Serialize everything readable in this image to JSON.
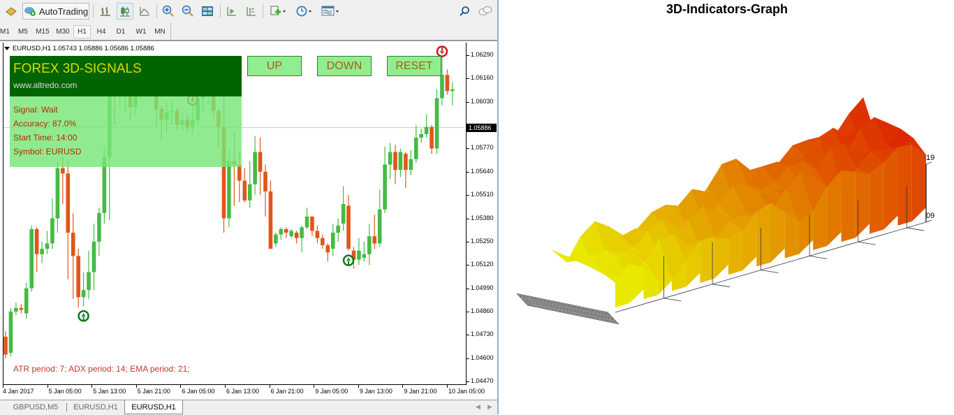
{
  "toolbar": {
    "autotrading_label": "AutoTrading",
    "icons": [
      "new-order-icon",
      "autotrading-icon",
      "bar-chart-icon",
      "candlestick-icon",
      "line-chart-icon",
      "zoom-in-icon",
      "zoom-out-icon",
      "tile-windows-icon",
      "scroll-chart-icon",
      "chart-shift-icon",
      "indicators-icon",
      "periods-icon",
      "templates-icon",
      "search-icon",
      "chat-icon"
    ]
  },
  "timeframes": [
    "M1",
    "M5",
    "M15",
    "M30",
    "H1",
    "H4",
    "D1",
    "W1",
    "MN"
  ],
  "active_timeframe": "H1",
  "chart": {
    "header": "EURUSD,H1  1.05743 1.05886 1.05686 1.05886",
    "symbol": "EURUSD",
    "timeframe": "H1",
    "ohlc": {
      "open": "1.05743",
      "high": "1.05886",
      "low": "1.05686",
      "close": "1.05886"
    },
    "current_price": "1.05886",
    "price_ticks": [
      "1.06290",
      "1.06160",
      "1.06030",
      "1.05770",
      "1.05640",
      "1.05510",
      "1.05380",
      "1.05250",
      "1.05120",
      "1.04990",
      "1.04860",
      "1.04730",
      "1.04600",
      "1.04470"
    ],
    "price_range": [
      1.0447,
      1.0629
    ],
    "time_ticks": [
      "4 Jan 2017",
      "5 Jan 05:00",
      "5 Jan 13:00",
      "5 Jan 21:00",
      "6 Jan 05:00",
      "6 Jan 13:00",
      "6 Jan 21:00",
      "9 Jan 05:00",
      "9 Jan 13:00",
      "9 Jan 21:00",
      "10 Jan 05:00"
    ],
    "colors": {
      "bull": "#44bb44",
      "bear": "#e0561a",
      "panel_dark": "#006400",
      "panel_light": "#8ee88e"
    },
    "candles": [
      [
        1.0472,
        1.0462,
        1.0475,
        1.046
      ],
      [
        1.0463,
        1.0486,
        1.0488,
        1.0461
      ],
      [
        1.0486,
        1.0488,
        1.0491,
        1.0484
      ],
      [
        1.0488,
        1.0487,
        1.049,
        1.0485
      ],
      [
        1.0485,
        1.0499,
        1.0502,
        1.0482
      ],
      [
        1.0499,
        1.0532,
        1.0534,
        1.0497
      ],
      [
        1.0532,
        1.0518,
        1.0533,
        1.0508
      ],
      [
        1.0518,
        1.0521,
        1.0525,
        1.0513
      ],
      [
        1.0521,
        1.0524,
        1.0531,
        1.0518
      ],
      [
        1.0524,
        1.0538,
        1.0549,
        1.0521
      ],
      [
        1.0538,
        1.0566,
        1.057,
        1.053
      ],
      [
        1.0566,
        1.0563,
        1.0572,
        1.0546
      ],
      [
        1.0563,
        1.053,
        1.0571,
        1.0504
      ],
      [
        1.053,
        1.0517,
        1.0541,
        1.0493
      ],
      [
        1.0517,
        1.0494,
        1.0521,
        1.0488
      ],
      [
        1.0494,
        1.0498,
        1.0508,
        1.0489
      ],
      [
        1.0498,
        1.0508,
        1.052,
        1.0493
      ],
      [
        1.0508,
        1.0525,
        1.0535,
        1.0498
      ],
      [
        1.0525,
        1.0541,
        1.0544,
        1.0517
      ],
      [
        1.0541,
        1.0572,
        1.0578,
        1.0535
      ],
      [
        1.0572,
        1.0613,
        1.0617,
        1.0537
      ],
      [
        1.0613,
        1.061,
        1.0623,
        1.059
      ],
      [
        1.0608,
        1.0608,
        1.0611,
        1.06
      ],
      [
        1.0608,
        1.0609,
        1.0616,
        1.0597
      ],
      [
        1.0609,
        1.06,
        1.0611,
        1.0593
      ],
      [
        1.06,
        1.0608,
        1.061,
        1.0595
      ],
      [
        1.0608,
        1.0617,
        1.062,
        1.0605
      ],
      [
        1.0617,
        1.0613,
        1.0619,
        1.0607
      ],
      [
        1.0613,
        1.0615,
        1.0624,
        1.061
      ],
      [
        1.0615,
        1.0599,
        1.0616,
        1.0589
      ],
      [
        1.0599,
        1.0593,
        1.0601,
        1.0582
      ],
      [
        1.0593,
        1.0597,
        1.0603,
        1.0586
      ],
      [
        1.0597,
        1.0598,
        1.0604,
        1.059
      ],
      [
        1.0598,
        1.059,
        1.06,
        1.0587
      ],
      [
        1.059,
        1.0593,
        1.0597,
        1.0587
      ],
      [
        1.0593,
        1.0589,
        1.0596,
        1.0586
      ],
      [
        1.0589,
        1.0593,
        1.0601,
        1.0585
      ],
      [
        1.0593,
        1.0605,
        1.0611,
        1.059
      ],
      [
        1.0605,
        1.0614,
        1.062,
        1.0597
      ],
      [
        1.0614,
        1.062,
        1.0623,
        1.0602
      ],
      [
        1.062,
        1.0598,
        1.0621,
        1.0594
      ],
      [
        1.0598,
        1.0589,
        1.0599,
        1.0577
      ],
      [
        1.0589,
        1.0538,
        1.0626,
        1.053
      ],
      [
        1.0538,
        1.057,
        1.0577,
        1.0533
      ],
      [
        1.057,
        1.0568,
        1.0586,
        1.0545
      ],
      [
        1.0568,
        1.0559,
        1.0575,
        1.0547
      ],
      [
        1.0559,
        1.0548,
        1.0566,
        1.0547
      ],
      [
        1.0548,
        1.0557,
        1.057,
        1.0544
      ],
      [
        1.0557,
        1.0575,
        1.0584,
        1.0551
      ],
      [
        1.0575,
        1.0564,
        1.0583,
        1.0551
      ],
      [
        1.0564,
        1.0553,
        1.0568,
        1.0539
      ],
      [
        1.0553,
        1.0521,
        1.0559,
        1.0522
      ],
      [
        1.0524,
        1.0529,
        1.053,
        1.0522
      ],
      [
        1.0529,
        1.0532,
        1.0533,
        1.0526
      ],
      [
        1.0532,
        1.053,
        1.0533,
        1.0527
      ],
      [
        1.0528,
        1.0531,
        1.0532,
        1.0527
      ],
      [
        1.053,
        1.0527,
        1.0531,
        1.0524
      ],
      [
        1.0527,
        1.0533,
        1.0534,
        1.0519
      ],
      [
        1.0533,
        1.0539,
        1.0544,
        1.0532
      ],
      [
        1.0539,
        1.0531,
        1.0539,
        1.0528
      ],
      [
        1.0531,
        1.0527,
        1.0534,
        1.0524
      ],
      [
        1.0527,
        1.0523,
        1.0529,
        1.0521
      ],
      [
        1.0523,
        1.0519,
        1.0524,
        1.0514
      ],
      [
        1.0521,
        1.053,
        1.0535,
        1.0517
      ],
      [
        1.053,
        1.0534,
        1.0538,
        1.0525
      ],
      [
        1.0535,
        1.0546,
        1.0556,
        1.0531
      ],
      [
        1.0545,
        1.0521,
        1.0551,
        1.052
      ],
      [
        1.052,
        1.0515,
        1.0522,
        1.051
      ],
      [
        1.0515,
        1.052,
        1.0527,
        1.0512
      ],
      [
        1.0516,
        1.0518,
        1.0525,
        1.0514
      ],
      [
        1.0518,
        1.0528,
        1.0535,
        1.0512
      ],
      [
        1.0528,
        1.0524,
        1.054,
        1.0521
      ],
      [
        1.0524,
        1.0543,
        1.0554,
        1.0522
      ],
      [
        1.0543,
        1.0568,
        1.0578,
        1.0541
      ],
      [
        1.0568,
        1.0575,
        1.058,
        1.056
      ],
      [
        1.0575,
        1.0565,
        1.0579,
        1.0557
      ],
      [
        1.0565,
        1.0575,
        1.0577,
        1.0561
      ],
      [
        1.0574,
        1.0565,
        1.0575,
        1.0555
      ],
      [
        1.0565,
        1.0571,
        1.0576,
        1.0562
      ],
      [
        1.0571,
        1.0583,
        1.059,
        1.0569
      ],
      [
        1.0583,
        1.0585,
        1.0588,
        1.058
      ],
      [
        1.0585,
        1.0589,
        1.0596,
        1.0583
      ],
      [
        1.0589,
        1.0577,
        1.059,
        1.0574
      ],
      [
        1.0577,
        1.0605,
        1.061,
        1.0574
      ],
      [
        1.0605,
        1.0618,
        1.0628,
        1.0601
      ],
      [
        1.0618,
        1.0609,
        1.0621,
        1.0607
      ],
      [
        1.0609,
        1.061,
        1.0614,
        1.0601
      ]
    ],
    "signals": [
      {
        "type": "down",
        "candle": 26
      },
      {
        "type": "down",
        "candle": 36
      },
      {
        "type": "up",
        "candle": 15
      },
      {
        "type": "up",
        "candle": 66
      },
      {
        "type": "down",
        "candle": 84
      }
    ]
  },
  "panel": {
    "title": "FOREX 3D-SIGNALS",
    "url": "www.altredo.com",
    "signal": "Signal: Wait",
    "accuracy": "Accuracy: 87.0%",
    "start_time": "Start Time: 14:00",
    "symbol": "Symbol: EURUSD"
  },
  "buttons": {
    "up": "UP",
    "down": "DOWN",
    "reset": "RESET"
  },
  "params_text": "ATR period: 7; ADX period: 14; EMA period: 21;",
  "tabs": [
    {
      "label": "GBPUSD,M5",
      "active": false
    },
    {
      "label": "EURUSD,H1",
      "active": false
    },
    {
      "label": "EURUSD,H1",
      "active": true
    }
  ],
  "graph3d": {
    "title": "3D-Indicators-Graph",
    "z_max_label": "19",
    "z_min_label": "09",
    "color_low": "#e8e800",
    "color_high": "#dd2200"
  }
}
